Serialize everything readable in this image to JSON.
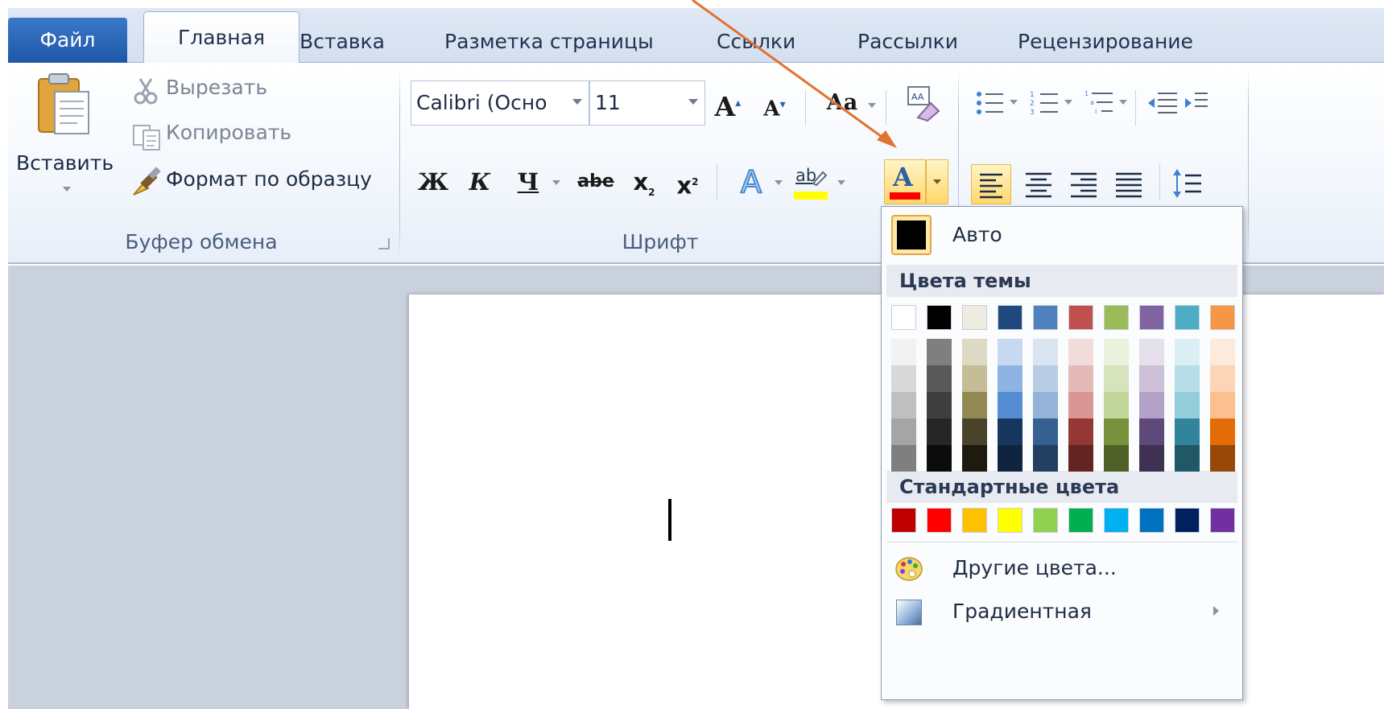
{
  "tabs": {
    "file": "Файл",
    "home": "Главная",
    "insert": "Вставка",
    "layout": "Разметка страницы",
    "references": "Ссылки",
    "mailings": "Рассылки",
    "review": "Рецензирование"
  },
  "clipboard": {
    "paste": "Вставить",
    "cut": "Вырезать",
    "copy": "Копировать",
    "format_painter": "Формат по образцу",
    "group_label": "Буфер обмена"
  },
  "font": {
    "font_name": "Calibri (Осно",
    "font_size": "11",
    "grow": "A",
    "shrink": "A",
    "change_case": "Aa",
    "bold": "Ж",
    "italic": "К",
    "underline": "Ч",
    "strike": "abe",
    "subscript": "x",
    "superscript": "x",
    "text_effects": "A",
    "highlight": "ab",
    "font_color": "A",
    "group_label": "Шрифт"
  },
  "color_menu": {
    "auto": "Авто",
    "theme_colors_heading": "Цвета темы",
    "standard_colors_heading": "Стандартные цвета",
    "more_colors": "Другие цвета...",
    "gradient": "Градиентная",
    "theme_base": [
      "#ffffff",
      "#000000",
      "#eeece1",
      "#1f497d",
      "#4f81bd",
      "#c0504d",
      "#9bbb59",
      "#8064a2",
      "#4bacc6",
      "#f79646"
    ],
    "theme_shades": [
      [
        "#f2f2f2",
        "#d8d8d8",
        "#bfbfbf",
        "#a5a5a5",
        "#7f7f7f"
      ],
      [
        "#7f7f7f",
        "#595959",
        "#3f3f3f",
        "#262626",
        "#0c0c0c"
      ],
      [
        "#ddd9c3",
        "#c4bd97",
        "#938953",
        "#494429",
        "#1d1b10"
      ],
      [
        "#c6d9f0",
        "#8db3e2",
        "#548dd4",
        "#17365d",
        "#0f243e"
      ],
      [
        "#dbe5f1",
        "#b8cce4",
        "#95b3d7",
        "#366092",
        "#244061"
      ],
      [
        "#f2dcdb",
        "#e5b9b7",
        "#d99694",
        "#953734",
        "#632423"
      ],
      [
        "#ebf1dd",
        "#d7e3bc",
        "#c3d69b",
        "#76923c",
        "#4f6128"
      ],
      [
        "#e5e0ec",
        "#ccc1d9",
        "#b2a2c7",
        "#5f497a",
        "#3f3151"
      ],
      [
        "#dbeef3",
        "#b7dde8",
        "#92cddc",
        "#31859b",
        "#205867"
      ],
      [
        "#fdeada",
        "#fbd5b5",
        "#fac08f",
        "#e36c09",
        "#974806"
      ]
    ],
    "standard": [
      "#c00000",
      "#ff0000",
      "#ffc000",
      "#ffff00",
      "#92d050",
      "#00b050",
      "#00b0f0",
      "#0070c0",
      "#002060",
      "#7030a0"
    ]
  },
  "accent": {
    "arrow": "#e2722f",
    "highlight": "#ffd76a"
  }
}
